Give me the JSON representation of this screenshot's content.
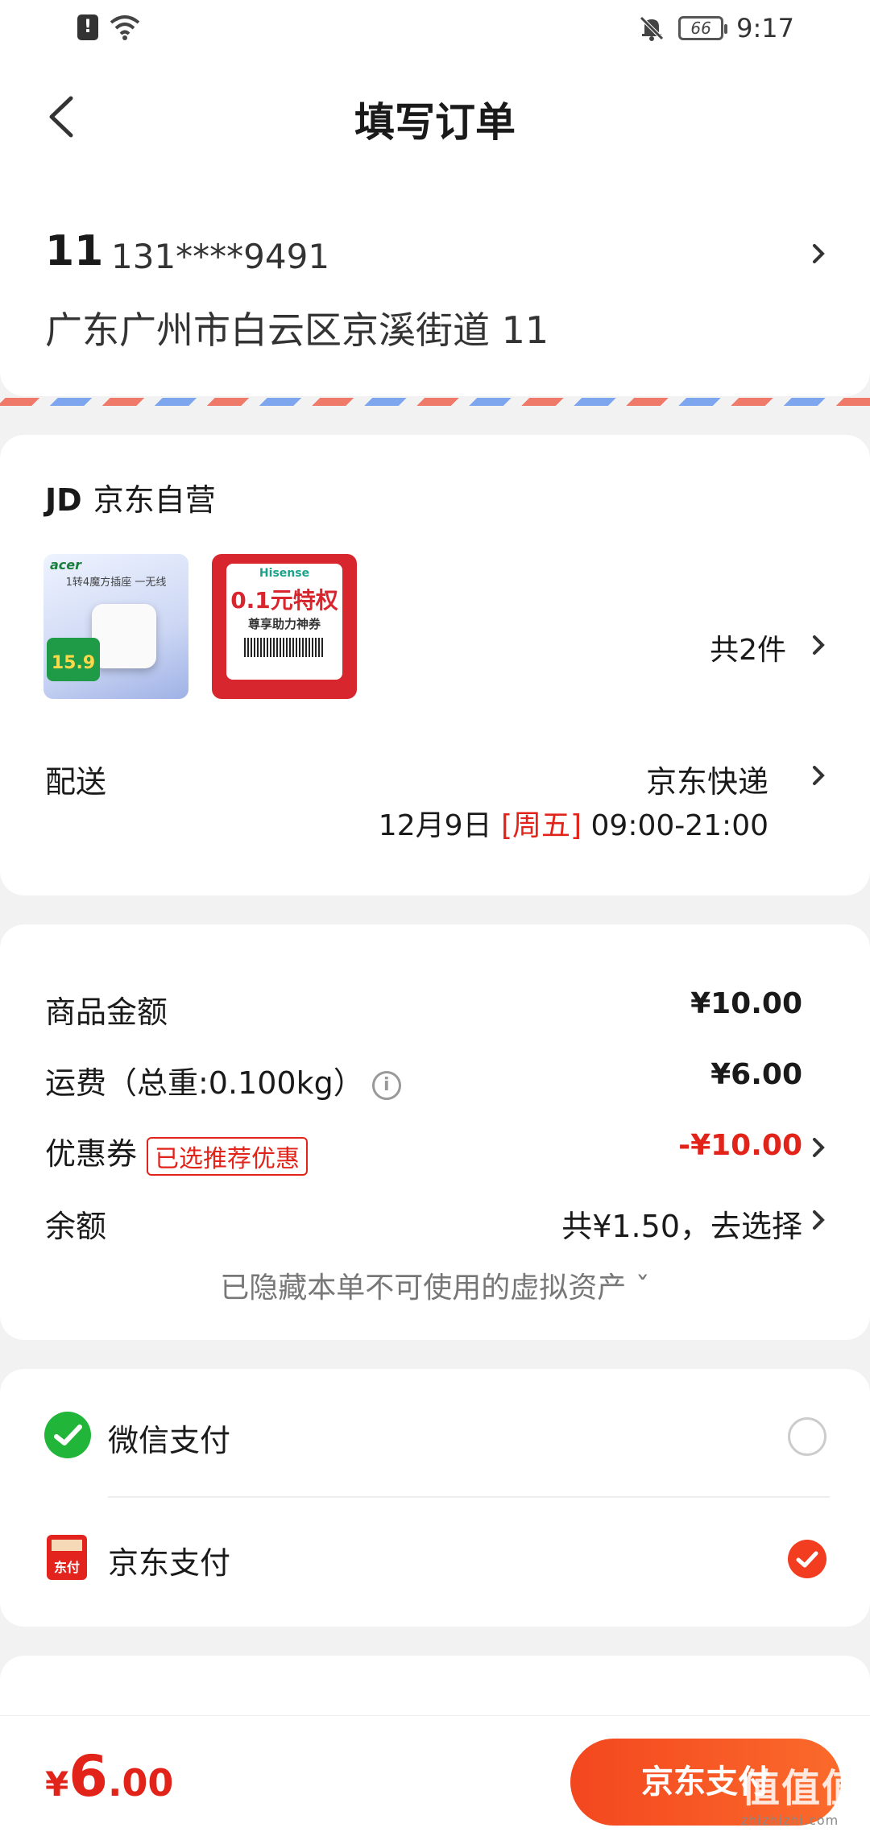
{
  "status_bar": {
    "time": "9:17",
    "battery": "66"
  },
  "header": {
    "title": "填写订单"
  },
  "address": {
    "name": "11",
    "phone": "131****9491",
    "line": "广东广州市白云区京溪街道 11"
  },
  "shop": {
    "logo": "JD",
    "name": "京东自营",
    "total_items": "共2件",
    "products": [
      {
        "brand": "acer",
        "title": "1转4魔方插座 一无线",
        "price_badge": "15.9"
      },
      {
        "brand": "Hisense",
        "headline": "0.1元特权",
        "subline": "尊享助力神券"
      }
    ],
    "shipping": {
      "label": "配送",
      "method": "京东快递",
      "date": "12月9日",
      "weekday": "[周五]",
      "time": "09:00-21:00"
    }
  },
  "price": {
    "goods_label": "商品金额",
    "goods_value": "¥10.00",
    "freight_label": "运费（总重:0.100kg）",
    "freight_value": "¥6.00",
    "coupon_label": "优惠券",
    "coupon_tag": "已选推荐优惠",
    "coupon_value": "-¥10.00",
    "balance_label": "余额",
    "balance_value": "共¥1.50，去选择",
    "hidden_note": "已隐藏本单不可使用的虚拟资产 ˇ"
  },
  "payment": {
    "options": [
      {
        "label": "微信支付",
        "selected": false
      },
      {
        "label": "京东支付",
        "selected": true
      }
    ]
  },
  "bottom": {
    "currency": "¥",
    "amount_int": "6",
    "amount_dec": ".00",
    "pay_button": "京东支付"
  },
  "watermark": {
    "main": "值值值",
    "sub": "zhizhizhi.com"
  },
  "colors": {
    "accent": "#f23d20",
    "price_red": "#e2231a"
  }
}
